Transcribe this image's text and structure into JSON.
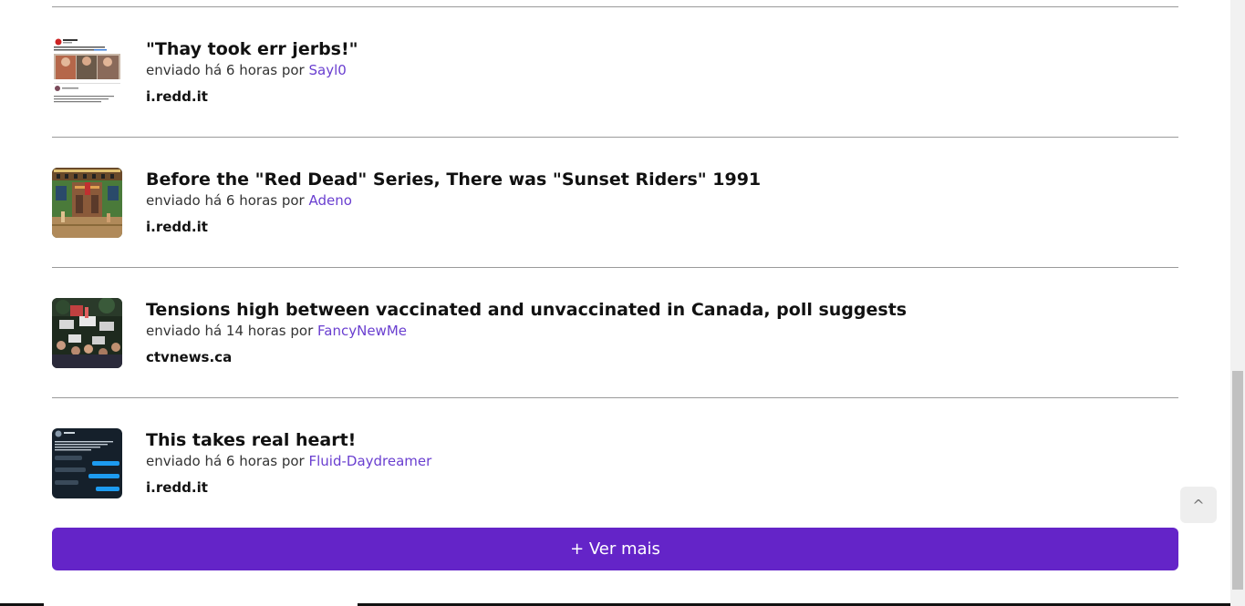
{
  "posts": [
    {
      "title": "\"Thay took err jerbs!\"",
      "meta_prefix": "enviado há 6 horas por ",
      "author": "Sayl0",
      "domain": "i.redd.it",
      "thumb_icon": "tweet-screenshot-thumbnail"
    },
    {
      "title": "Before the \"Red Dead\" Series, There was \"Sunset Riders\" 1991",
      "meta_prefix": "enviado há 6 horas por ",
      "author": "Adeno",
      "domain": "i.redd.it",
      "thumb_icon": "pixel-game-thumbnail"
    },
    {
      "title": "Tensions high between vaccinated and unvaccinated in Canada, poll suggests",
      "meta_prefix": "enviado há 14 horas por ",
      "author": "FancyNewMe",
      "domain": "ctvnews.ca",
      "thumb_icon": "protest-crowd-thumbnail"
    },
    {
      "title": "This takes real heart!",
      "meta_prefix": "enviado há 6 horas por ",
      "author": "Fluid-Daydreamer",
      "domain": "i.redd.it",
      "thumb_icon": "dark-tweet-thumbnail"
    }
  ],
  "more_button": {
    "label": "+ Ver mais"
  },
  "back_to_top": {
    "label": "^"
  },
  "colors": {
    "accent": "#6424c8",
    "author_link": "#6a3fd0",
    "divider": "#9a9a9a"
  }
}
